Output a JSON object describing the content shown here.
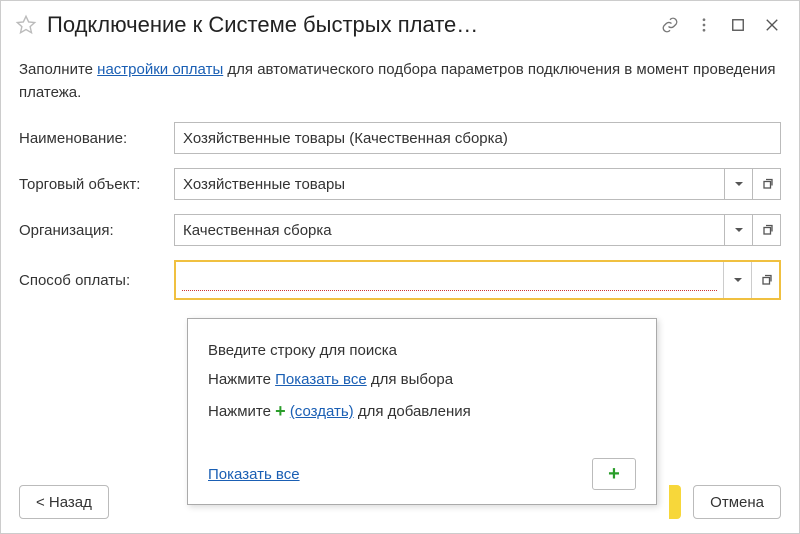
{
  "title": "Подключение к Системе быстрых плате…",
  "instruction": {
    "prefix": "Заполните ",
    "link": "настройки оплаты",
    "suffix": " для автоматического подбора параметров подключения в момент проведения платежа."
  },
  "labels": {
    "name": "Наименование:",
    "tradeObject": "Торговый объект:",
    "org": "Организация:",
    "paymentMethod": "Способ оплаты:"
  },
  "fields": {
    "name": "Хозяйственные товары (Качественная сборка)",
    "tradeObject": "Хозяйственные товары",
    "org": "Качественная сборка",
    "paymentMethod": ""
  },
  "dropdown": {
    "searchHint": "Введите строку для поиска",
    "showAllPrefix": "Нажмите ",
    "showAllLink": "Показать все",
    "showAllSuffix": " для выбора",
    "createPrefix": "Нажмите ",
    "createLink": "(создать)",
    "createSuffix": " для добавления",
    "footerShowAll": "Показать все"
  },
  "buttons": {
    "back": "< Назад",
    "cancel": "Отмена"
  }
}
